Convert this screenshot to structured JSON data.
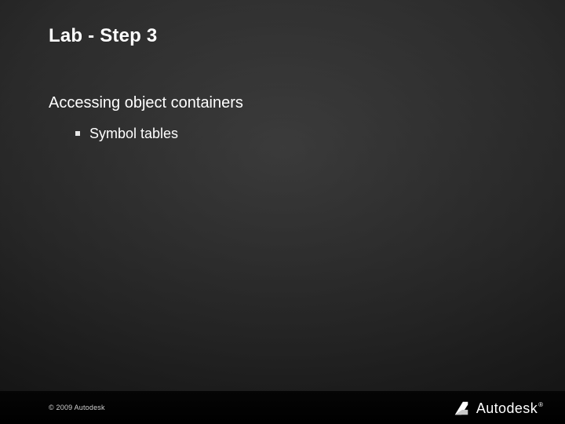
{
  "title": "Lab - Step 3",
  "subtitle": "Accessing object containers",
  "bullets": [
    {
      "text": "Symbol tables"
    }
  ],
  "footer": {
    "copyright": "© 2009 Autodesk",
    "logo_text": "Autodesk",
    "registered": "®"
  }
}
